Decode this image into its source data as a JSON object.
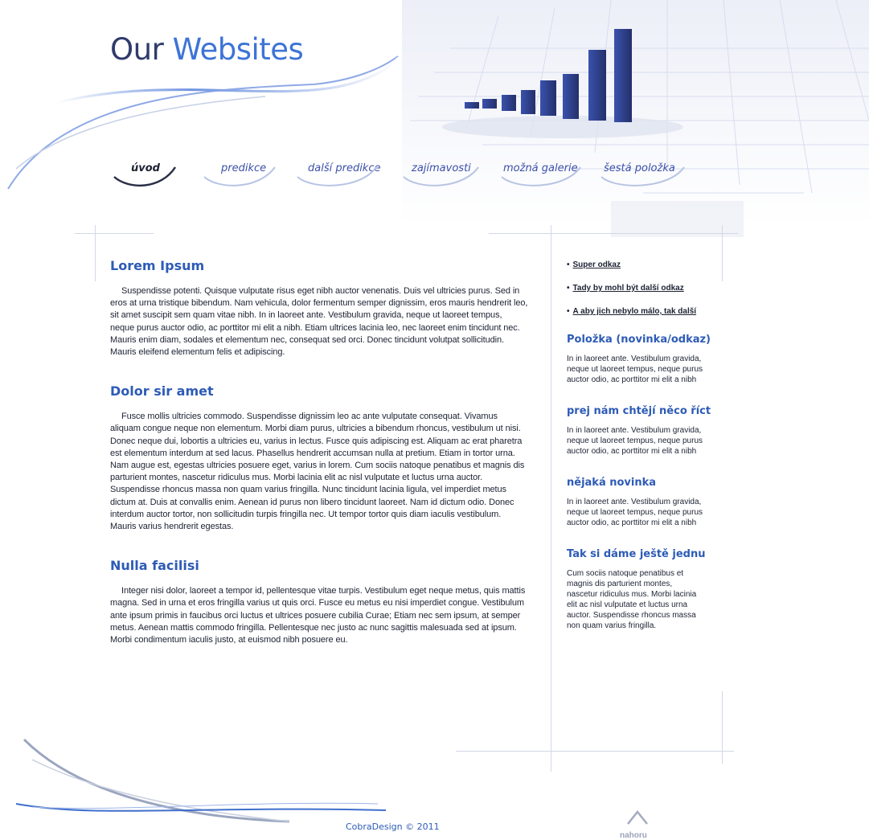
{
  "logo": {
    "word1": "Our",
    "word2": "Websites"
  },
  "nav": {
    "items": [
      {
        "label": "úvod",
        "active": true
      },
      {
        "label": "predikce",
        "active": false
      },
      {
        "label": "další predikce",
        "active": false
      },
      {
        "label": "zajímavosti",
        "active": false
      },
      {
        "label": "možná galerie",
        "active": false
      },
      {
        "label": "šestá položka",
        "active": false
      }
    ]
  },
  "articles": [
    {
      "title": "Lorem Ipsum",
      "body": "Suspendisse potenti. Quisque vulputate risus eget nibh auctor venenatis. Duis vel ultricies purus. Sed in eros at urna tristique bibendum. Nam vehicula, dolor fermentum semper dignissim, eros mauris hendrerit leo, sit amet suscipit sem quam vitae nibh. In in laoreet ante. Vestibulum gravida, neque ut laoreet tempus, neque purus auctor odio, ac porttitor mi elit a nibh. Etiam ultrices lacinia leo, nec laoreet enim tincidunt nec. Mauris enim diam, sodales et elementum nec, consequat sed orci. Donec tincidunt volutpat sollicitudin. Mauris eleifend elementum felis et adipiscing."
    },
    {
      "title": "Dolor sir amet",
      "body": "Fusce mollis ultricies commodo. Suspendisse dignissim leo ac ante vulputate consequat. Vivamus aliquam congue neque non elementum. Morbi diam purus, ultricies a bibendum rhoncus, vestibulum ut nisi. Donec neque dui, lobortis a ultricies eu, varius in lectus. Fusce quis adipiscing est. Aliquam ac erat pharetra est elementum interdum at sed lacus. Phasellus hendrerit accumsan nulla at pretium. Etiam in tortor urna. Nam augue est, egestas ultricies posuere eget, varius in lorem. Cum sociis natoque penatibus et magnis dis parturient montes, nascetur ridiculus mus. Morbi lacinia elit ac nisl vulputate et luctus urna auctor. Suspendisse rhoncus massa non quam varius fringilla. Nunc tincidunt lacinia ligula, vel imperdiet metus dictum at. Duis at convallis enim. Aenean id purus non libero tincidunt laoreet. Nam id dictum odio. Donec interdum auctor tortor, non sollicitudin turpis fringilla nec. Ut tempor tortor quis diam iaculis vestibulum. Mauris varius hendrerit egestas."
    },
    {
      "title": "Nulla facilisi",
      "body": "Integer nisi dolor, laoreet a tempor id, pellentesque vitae turpis. Vestibulum eget neque metus, quis mattis magna. Sed in urna et eros fringilla varius ut quis orci. Fusce eu metus eu nisi imperdiet congue. Vestibulum ante ipsum primis in faucibus orci luctus et ultrices posuere cubilia Curae; Etiam nec sem ipsum, at semper metus. Aenean mattis commodo fringilla. Pellentesque nec justo ac nunc sagittis malesuada sed at ipsum. Morbi condimentum iaculis justo, at euismod nibh posuere eu."
    }
  ],
  "sidebar": {
    "links": [
      {
        "label": "Super odkaz"
      },
      {
        "label": "Tady by mohl být další odkaz"
      },
      {
        "label": "A aby jich nebylo málo, tak další"
      }
    ],
    "blocks": [
      {
        "title": "Položka (novinka/odkaz)",
        "text": "In in laoreet ante. Vestibulum gravida, neque ut laoreet tempus, neque purus auctor odio, ac porttitor mi elit a nibh"
      },
      {
        "title": "prej nám chtějí něco říct",
        "text": "In in laoreet ante. Vestibulum gravida, neque ut laoreet tempus, neque purus auctor odio, ac porttitor mi elit a nibh"
      },
      {
        "title": "nějaká novinka",
        "text": "In in laoreet ante. Vestibulum gravida, neque ut laoreet tempus, neque purus auctor odio, ac porttitor mi elit a nibh"
      },
      {
        "title": "Tak si dáme ještě jednu",
        "text": "Cum sociis natoque penatibus et magnis dis parturient montes, nascetur ridiculus mus. Morbi lacinia elit ac nisl vulputate et luctus urna auctor. Suspendisse rhoncus massa non quam varius fringilla."
      }
    ]
  },
  "footer": {
    "copyright": "CobraDesign © 2011",
    "top_label": "nahoru",
    "top_icon": "chevron-up-icon"
  },
  "colors": {
    "accent": "#3d74d6",
    "heading": "#2d5bb6",
    "logo_dark": "#2f3b6b",
    "bar": "#2e3f8f"
  }
}
